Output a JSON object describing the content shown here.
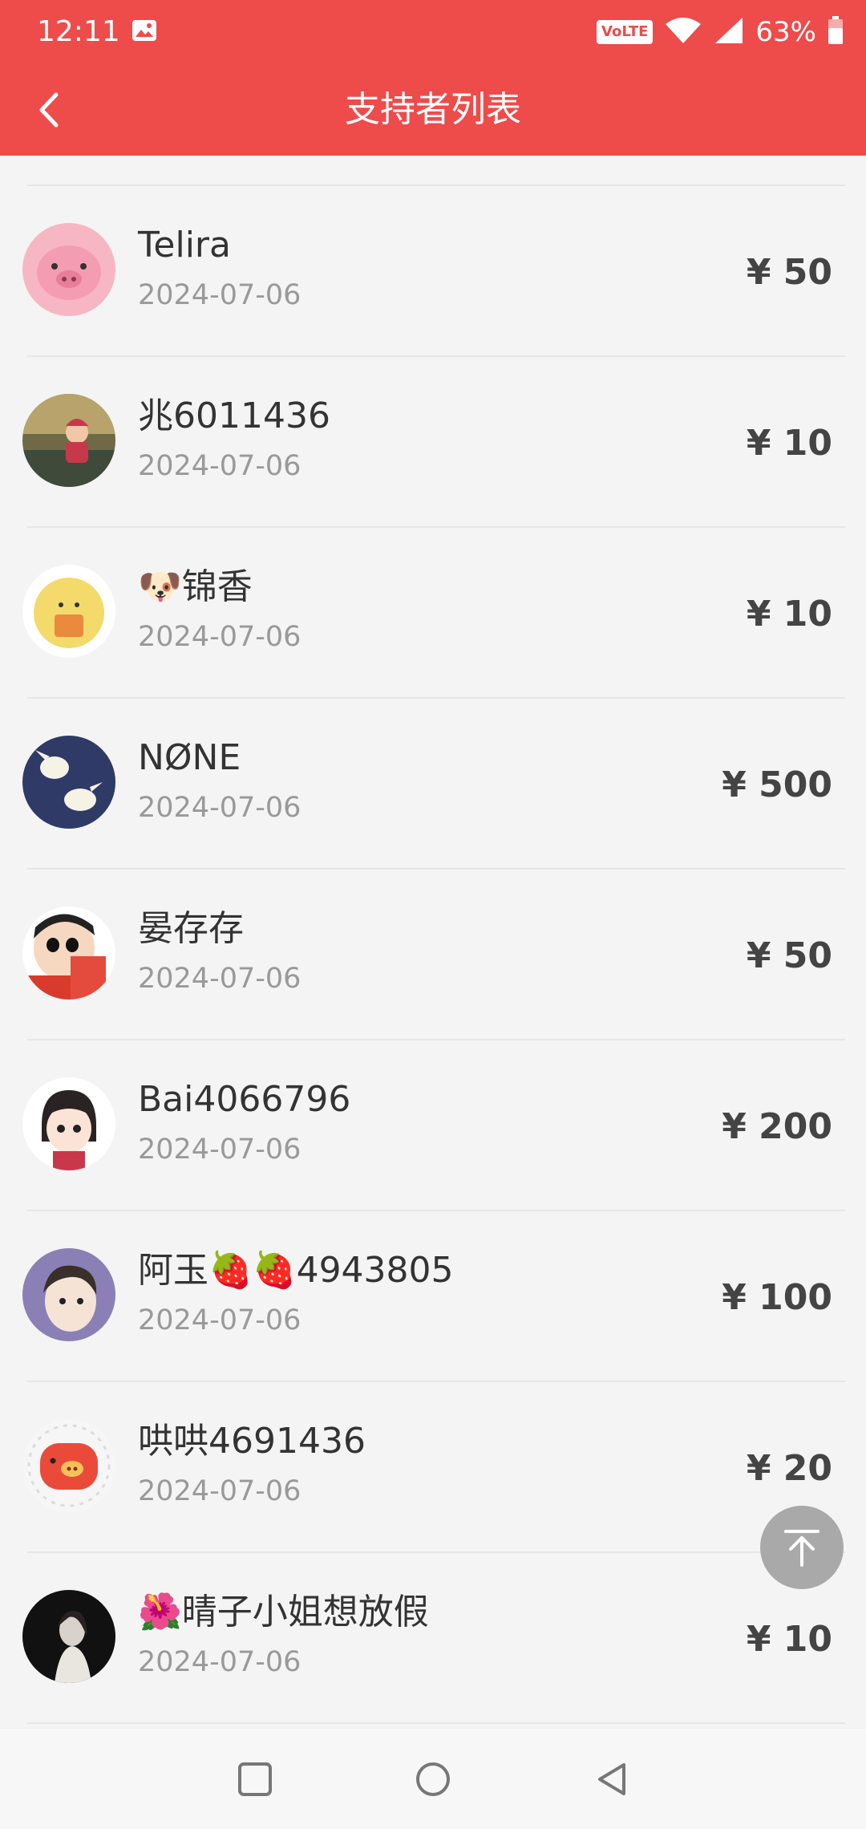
{
  "status_bar": {
    "time": "12:11",
    "volte": "VoLTE",
    "battery": "63%"
  },
  "header": {
    "title": "支持者列表"
  },
  "supporters": [
    {
      "name": "Telira",
      "date": "2024-07-06",
      "amount": "¥ 50"
    },
    {
      "name": "兆6011436",
      "date": "2024-07-06",
      "amount": "¥ 10"
    },
    {
      "name": "🐶锦香",
      "date": "2024-07-06",
      "amount": "¥ 10"
    },
    {
      "name": "NØNE",
      "date": "2024-07-06",
      "amount": "¥ 500"
    },
    {
      "name": "晏存存",
      "date": "2024-07-06",
      "amount": "¥ 50"
    },
    {
      "name": "Bai4066796",
      "date": "2024-07-06",
      "amount": "¥ 200"
    },
    {
      "name": "阿玉🍓🍓4943805",
      "date": "2024-07-06",
      "amount": "¥ 100"
    },
    {
      "name": "哄哄4691436",
      "date": "2024-07-06",
      "amount": "¥ 20"
    },
    {
      "name": "🌺晴子小姐想放假",
      "date": "2024-07-06",
      "amount": "¥ 10"
    }
  ],
  "colors": {
    "header_bg": "#ee4b4b",
    "page_bg": "#f4f4f4",
    "name_text": "#333333",
    "date_text": "#999999",
    "amount_text": "#444444"
  }
}
